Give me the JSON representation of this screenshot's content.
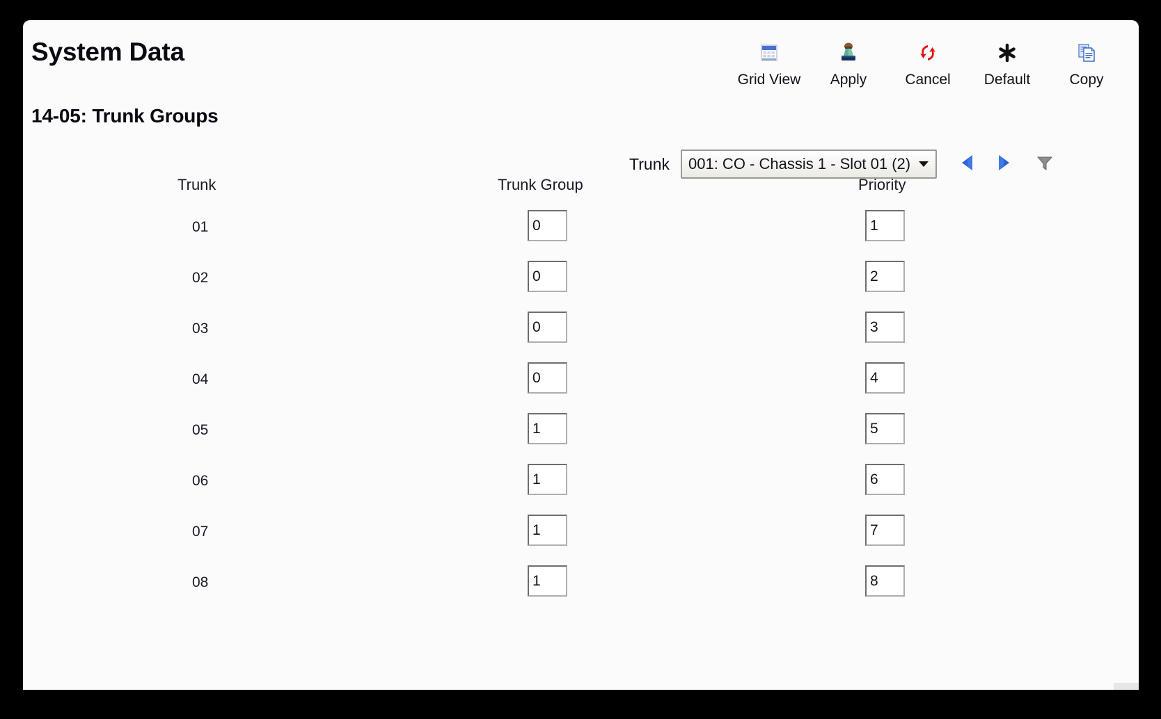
{
  "window": {
    "app_title": "System Data",
    "page_title": "14-05: Trunk Groups"
  },
  "toolbar": {
    "items": [
      {
        "label": "Grid View",
        "icon": "grid-view-icon"
      },
      {
        "label": "Apply",
        "icon": "stamp-icon"
      },
      {
        "label": "Cancel",
        "icon": "refresh-undo-icon"
      },
      {
        "label": "Default",
        "icon": "asterisk-icon"
      },
      {
        "label": "Copy",
        "icon": "copy-pages-icon"
      }
    ]
  },
  "selector": {
    "label": "Trunk",
    "value": "001: CO - Chassis 1 - Slot 01 (2)",
    "options": [
      "001: CO - Chassis 1 - Slot 01 (2)"
    ],
    "prev_icon": "triangle-left-icon",
    "next_icon": "triangle-right-icon",
    "filter_icon": "funnel-icon"
  },
  "table": {
    "headers": [
      "Trunk",
      "Trunk Group",
      "Priority"
    ],
    "rows": [
      {
        "trunk": "01",
        "trunk_group": "0",
        "priority": "1"
      },
      {
        "trunk": "02",
        "trunk_group": "0",
        "priority": "2"
      },
      {
        "trunk": "03",
        "trunk_group": "0",
        "priority": "3"
      },
      {
        "trunk": "04",
        "trunk_group": "0",
        "priority": "4"
      },
      {
        "trunk": "05",
        "trunk_group": "1",
        "priority": "5"
      },
      {
        "trunk": "06",
        "trunk_group": "1",
        "priority": "6"
      },
      {
        "trunk": "07",
        "trunk_group": "1",
        "priority": "7"
      },
      {
        "trunk": "08",
        "trunk_group": "1",
        "priority": "8"
      }
    ]
  },
  "colors": {
    "frame": "#000000",
    "panel": "#fbfbfb",
    "text": "#0a0a12",
    "accent_blue": "#2f62d6",
    "cancel_red": "#e01010",
    "combo_border": "#9a9a96"
  }
}
